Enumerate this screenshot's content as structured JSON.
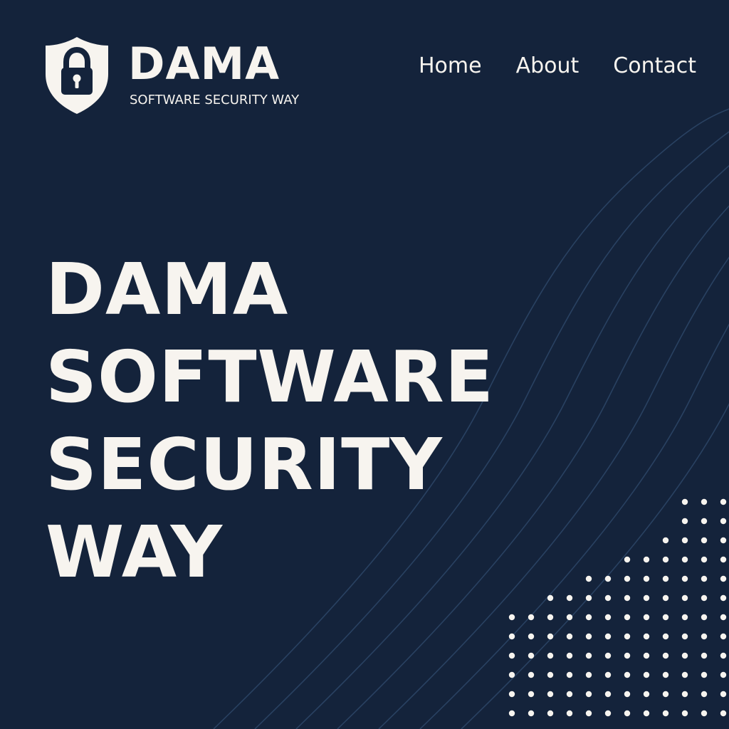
{
  "brand": {
    "name": "DAMA",
    "tagline": "SOFTWARE SECURITY WAY",
    "logo_icon": "shield-lock-icon"
  },
  "nav": {
    "items": [
      {
        "label": "Home"
      },
      {
        "label": "About"
      },
      {
        "label": "Contact"
      }
    ]
  },
  "hero": {
    "lines": [
      "DAMA",
      "SOFTWARE",
      "SECURITY",
      "WAY"
    ]
  },
  "colors": {
    "background": "#14233b",
    "text": "#f7f4ef",
    "decor_lines": "#2d4768",
    "decor_dots": "#f7f4ef"
  }
}
